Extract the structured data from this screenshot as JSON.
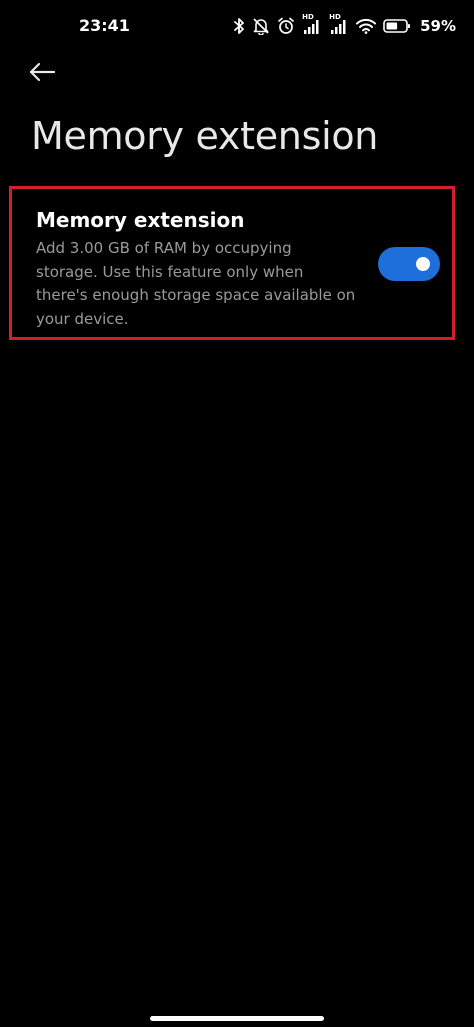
{
  "status_bar": {
    "time": "23:41",
    "battery_percent": "59%",
    "battery_level": 0.59,
    "icons": [
      "bluetooth-icon",
      "alarm-off-icon",
      "alarm-icon",
      "signal-hd-icon",
      "signal-hd-icon",
      "wifi-icon",
      "battery-icon"
    ],
    "network_badge_1": "HD",
    "network_badge_2": "HD"
  },
  "header": {
    "back_icon": "arrow-left-icon",
    "title": "Memory extension"
  },
  "setting": {
    "title": "Memory extension",
    "description": "Add 3.00 GB of RAM by occupying storage. Use this feature only when there's enough storage space available on your device.",
    "enabled": true
  },
  "colors": {
    "background": "#000000",
    "accent": "#1e6fd9",
    "highlight_border": "#d0202e",
    "secondary_text": "#9a9a9a"
  }
}
